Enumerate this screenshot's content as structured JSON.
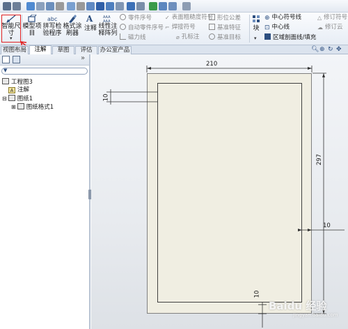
{
  "ribbon": {
    "smart_dim": "智能尺寸",
    "model_items": "模型项目",
    "spell_check": "拼写检验程序",
    "format_painter": "格式涂刷器",
    "note": "注释",
    "linear_pattern": "线性注释阵列",
    "balloon": "零件序号",
    "auto_balloon": "自动零件序号",
    "magnetic_line": "磁力线",
    "surface_finish": "表面粗糙度符号",
    "weld_symbol": "焊接符号",
    "hole_callout": "孔标注",
    "gtol": "形位公差",
    "datum_feature": "基准特征",
    "datum_target": "基准目标",
    "block": "块",
    "center_mark": "中心符号线",
    "centerline": "中心线",
    "area_hatch": "区域剖面线/填充",
    "rev_symbol": "修订符号",
    "rev_cloud": "修订云"
  },
  "tabs": [
    "视图布局",
    "注解",
    "草图",
    "评估",
    "办公室产品"
  ],
  "active_tab": "注解",
  "tree": {
    "root": "工程图3",
    "annotations": "注解",
    "sheet": "图纸1",
    "sheet_format": "图纸格式1"
  },
  "dims": {
    "width": "210",
    "height": "297",
    "margin_top": "10",
    "margin_right": "10",
    "margin_bottom": "10"
  },
  "watermark": "Baidu 经验",
  "watermark_url": "jingyan.baidu.com"
}
